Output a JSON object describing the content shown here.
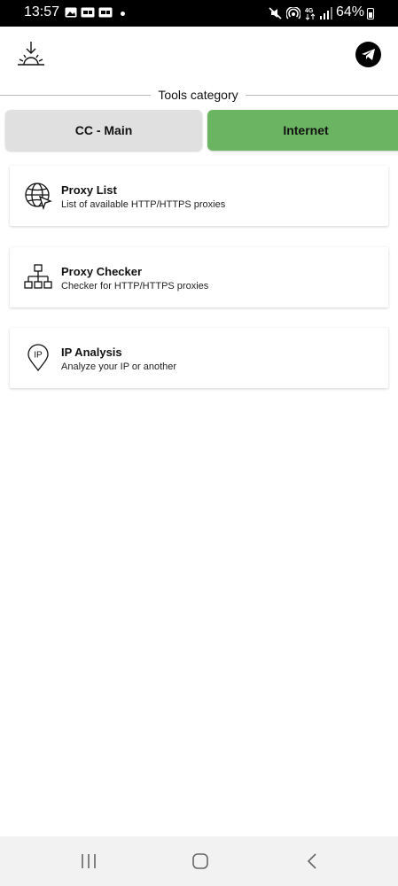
{
  "status_bar": {
    "time": "13:57",
    "battery": "64%",
    "icons": [
      "gallery-icon",
      "notification-icon",
      "notification-icon",
      "mute-icon",
      "hotspot-icon",
      "4g-icon",
      "signal-icon",
      "battery-icon"
    ]
  },
  "header": {
    "logo_icon": "sunrise-download-icon",
    "telegram_icon": "telegram-icon"
  },
  "category": {
    "title": "Tools category"
  },
  "tabs": [
    {
      "label": "CC - Main",
      "active": false
    },
    {
      "label": "Internet",
      "active": true
    }
  ],
  "tools": [
    {
      "icon": "globe-cursor-icon",
      "title": "Proxy List",
      "subtitle": "List of available HTTP/HTTPS proxies"
    },
    {
      "icon": "network-tree-icon",
      "title": "Proxy Checker",
      "subtitle": "Checker for HTTP/HTTPS proxies"
    },
    {
      "icon": "ip-pin-icon",
      "title": "IP Analysis",
      "subtitle": "Analyze your IP or another",
      "icon_text": "IP"
    }
  ],
  "colors": {
    "active_tab": "#6ab462",
    "inactive_tab": "#e0e0e0",
    "status_bar": "#000000",
    "nav_bar": "#f2f2f2"
  },
  "nav_bar": {
    "icons": [
      "recent-apps-icon",
      "home-icon",
      "back-icon"
    ]
  }
}
